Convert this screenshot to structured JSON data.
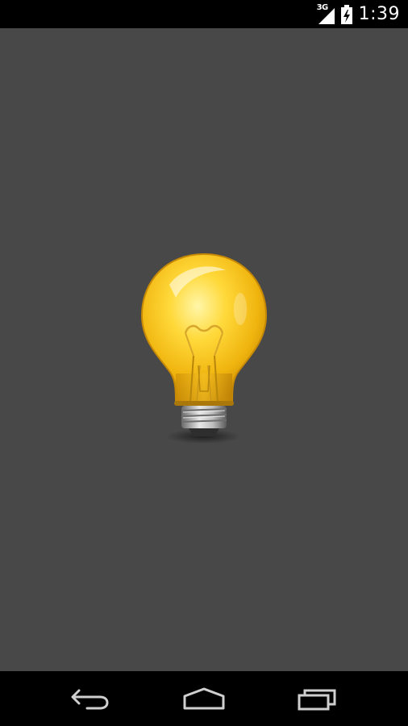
{
  "status_bar": {
    "network_type": "3G",
    "time": "1:39",
    "icons": [
      "signal-icon",
      "battery-charging-icon"
    ]
  },
  "main": {
    "image": "light-bulb",
    "background_color": "#484848"
  },
  "nav_bar": {
    "icons": [
      "back-icon",
      "home-icon",
      "recent-apps-icon"
    ]
  }
}
